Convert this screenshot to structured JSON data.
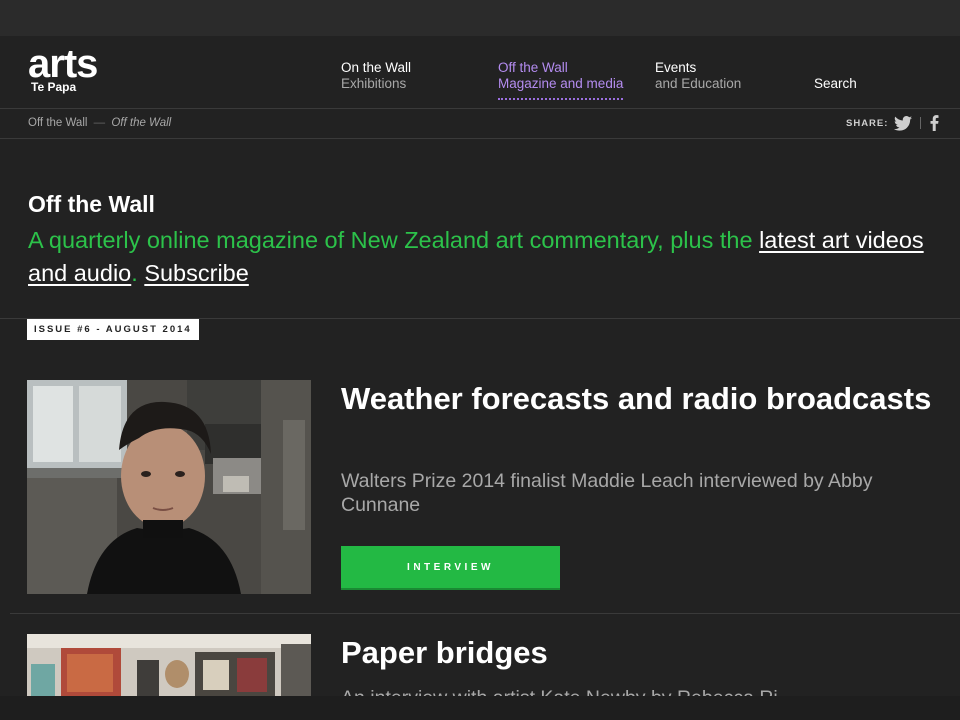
{
  "header": {
    "logo": "arts",
    "logo_sub": "Te Papa",
    "nav": [
      {
        "line1": "On the Wall",
        "line2": "Exhibitions",
        "active": false
      },
      {
        "line1": "Off the Wall",
        "line2": "Magazine and media",
        "active": true
      },
      {
        "line1": "Events",
        "line2": "and Education",
        "active": false
      }
    ],
    "search_label": "Search"
  },
  "breadcrumb": {
    "parent": "Off the Wall",
    "separator": "—",
    "current": "Off the Wall"
  },
  "share": {
    "label": "SHARE:",
    "icons": [
      "twitter-icon",
      "facebook-icon"
    ]
  },
  "intro": {
    "title": "Off the Wall",
    "text": "A quarterly online magazine of New Zealand art commentary, plus the ",
    "link_videos": "latest art videos and audio",
    "period": ". ",
    "link_subscribe": "Subscribe"
  },
  "issue_badge": "ISSUE #6 - AUGUST 2014",
  "articles": [
    {
      "title": "Weather forecasts and radio broadcasts",
      "description": "Walters Prize 2014 finalist Maddie Leach interviewed by Abby Cunnane",
      "button": "INTERVIEW"
    },
    {
      "title": "Paper bridges",
      "description": "An interview with artist Kate Newby by Rebecca Ri..."
    }
  ],
  "colors": {
    "accent_green": "#2cc24a",
    "button_green": "#23b944",
    "nav_active_purple": "#b48cf0",
    "background": "#222222"
  }
}
